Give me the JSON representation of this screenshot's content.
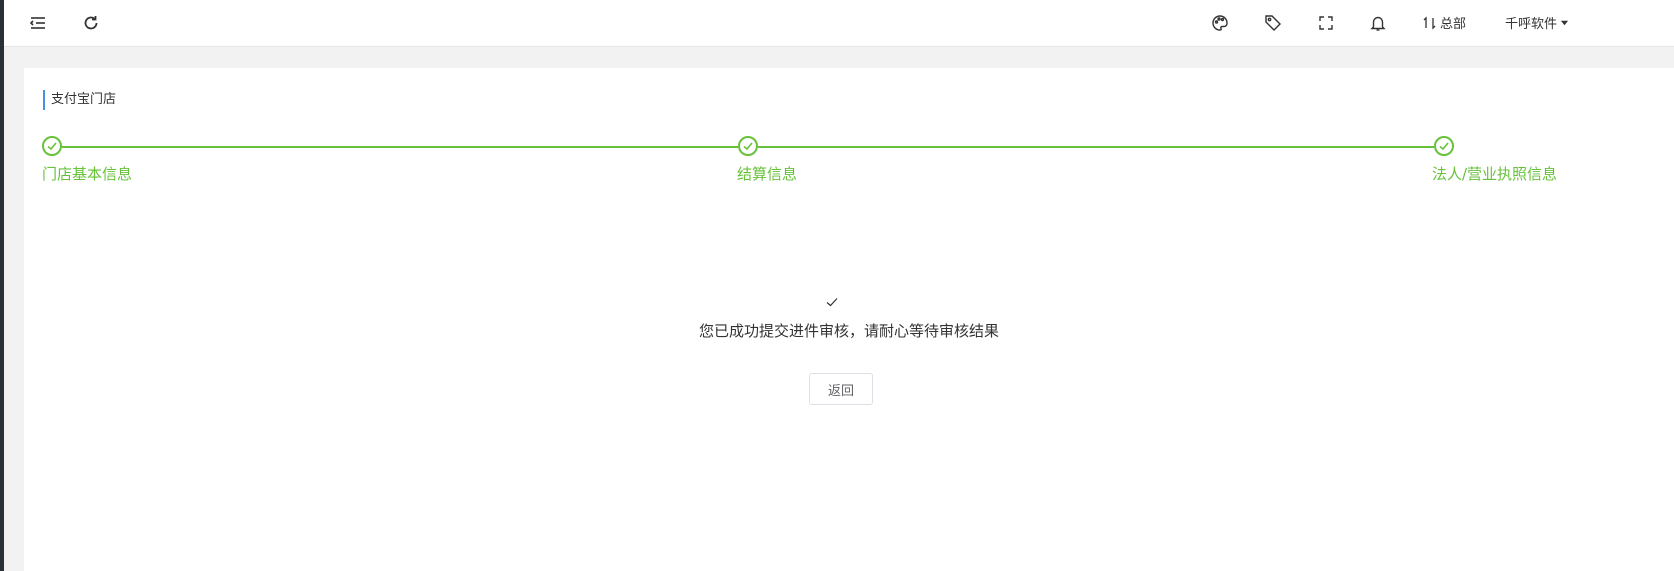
{
  "header": {
    "icons": [
      "menu-fold-icon",
      "refresh-icon",
      "palette-icon",
      "tag-icon",
      "fullscreen-icon",
      "bell-icon"
    ],
    "branch_label": "总部",
    "user_label": "千呼软件"
  },
  "card": {
    "title": "支付宝门店"
  },
  "steps": [
    {
      "label": "门店基本信息",
      "status": "finished"
    },
    {
      "label": "结算信息",
      "status": "finished"
    },
    {
      "label": "法人/营业执照信息",
      "status": "finished"
    }
  ],
  "result": {
    "message": "您已成功提交进件审核，请耐心等待审核结果",
    "back_label": "返回"
  },
  "colors": {
    "success": "#67c23a",
    "accent": "#4a90e2"
  }
}
